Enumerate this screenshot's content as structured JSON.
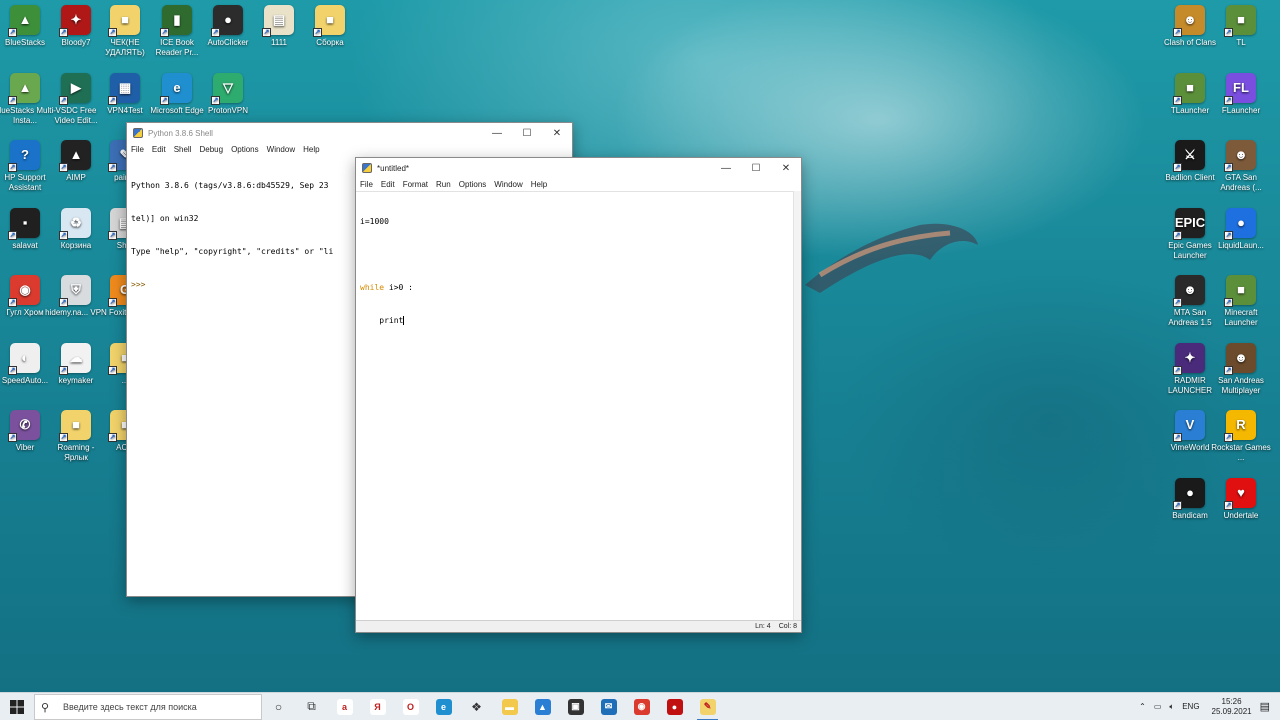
{
  "desktop": {
    "left_icons": [
      {
        "label": "BlueStacks",
        "color": "#3d8f3a",
        "glyph": "▲"
      },
      {
        "label": "Bloody7",
        "color": "#b01818",
        "glyph": "✦"
      },
      {
        "label": "ЧЕК(НЕ УДАЛЯТЬ)",
        "color": "#f2d36b",
        "glyph": "■"
      },
      {
        "label": "ICE Book Reader Pr...",
        "color": "#2f6b2f",
        "glyph": "▮"
      },
      {
        "label": "AutoClicker",
        "color": "#2c2c2c",
        "glyph": "●"
      },
      {
        "label": "1111",
        "color": "#e9e2c8",
        "glyph": "▤"
      },
      {
        "label": "Сборка",
        "color": "#f2d36b",
        "glyph": "■"
      },
      {
        "label": "BlueStacks Multi-Insta...",
        "color": "#6aa84f",
        "glyph": "▲"
      },
      {
        "label": "VSDC Free Video Edit...",
        "color": "#1f6f54",
        "glyph": "▶"
      },
      {
        "label": "VPN4Test",
        "color": "#1f5fa8",
        "glyph": "▦"
      },
      {
        "label": "Microsoft Edge",
        "color": "#1f8fd0",
        "glyph": "e"
      },
      {
        "label": "ProtonVPN",
        "color": "#2eab6e",
        "glyph": "▽"
      },
      {
        "label": "HP Support Assistant",
        "color": "#1a73c9",
        "glyph": "?"
      },
      {
        "label": "AIMP",
        "color": "#222222",
        "glyph": "▲"
      },
      {
        "label": "pain...",
        "color": "#3c6fb6",
        "glyph": "✎"
      },
      {
        "label": "salavat",
        "color": "#202020",
        "glyph": "▪"
      },
      {
        "label": "Корзина",
        "color": "#d8e7f2",
        "glyph": "♻"
      },
      {
        "label": "Sh...",
        "color": "#d6d6d6",
        "glyph": "▤"
      },
      {
        "label": "Гугл Хром",
        "color": "#db3b2f",
        "glyph": "◉"
      },
      {
        "label": "hidemy.na... VPN",
        "color": "#d9dcdf",
        "glyph": "⛨"
      },
      {
        "label": "Foxit R...",
        "color": "#f08a1c",
        "glyph": "G"
      },
      {
        "label": "SpeedAuto...",
        "color": "#efefef",
        "glyph": "◐"
      },
      {
        "label": "keymaker",
        "color": "#f2f2f2",
        "glyph": "☁"
      },
      {
        "label": "...",
        "color": "#f2d36b",
        "glyph": "■"
      },
      {
        "label": "Viber",
        "color": "#7b519d",
        "glyph": "✆"
      },
      {
        "label": "Roaming - Ярлык",
        "color": "#f2d36b",
        "glyph": "■"
      },
      {
        "label": "AC...",
        "color": "#f2d36b",
        "glyph": "■"
      }
    ],
    "right_icons": [
      {
        "label": "Clash of Clans",
        "color": "#c58a2a",
        "glyph": "☻"
      },
      {
        "label": "TL",
        "color": "#5c8f3a",
        "glyph": "■"
      },
      {
        "label": "TLauncher",
        "color": "#5c8f3a",
        "glyph": "■"
      },
      {
        "label": "FLauncher",
        "color": "#7a4fe0",
        "glyph": "FL"
      },
      {
        "label": "Badlion Client",
        "color": "#1a1a1a",
        "glyph": "⚔"
      },
      {
        "label": "GTA San Andreas (...",
        "color": "#7d5a3a",
        "glyph": "☻"
      },
      {
        "label": "Epic Games Launcher",
        "color": "#202020",
        "glyph": "EPIC"
      },
      {
        "label": "LiquidLaun...",
        "color": "#1e6fe0",
        "glyph": "●"
      },
      {
        "label": "MTA San Andreas 1.5",
        "color": "#2a2a2a",
        "glyph": "☻"
      },
      {
        "label": "Minecraft Launcher",
        "color": "#5c8f3a",
        "glyph": "■"
      },
      {
        "label": "RADMIR LAUNCHER",
        "color": "#4a2a7a",
        "glyph": "✦"
      },
      {
        "label": "San Andreas Multiplayer",
        "color": "#6b4b2b",
        "glyph": "☻"
      },
      {
        "label": "VimeWorld",
        "color": "#2a7fd4",
        "glyph": "V"
      },
      {
        "label": "Rockstar Games ...",
        "color": "#f5b800",
        "glyph": "R"
      },
      {
        "label": "Bandicam",
        "color": "#1a1a1a",
        "glyph": "●"
      },
      {
        "label": "Undertale",
        "color": "#e01010",
        "glyph": "♥"
      }
    ]
  },
  "shell_window": {
    "title": "Python 3.8.6 Shell",
    "menu": [
      "File",
      "Edit",
      "Shell",
      "Debug",
      "Options",
      "Window",
      "Help"
    ],
    "lines": [
      "Python 3.8.6 (tags/v3.8.6:db45529, Sep 23",
      "tel)] on win32",
      "Type \"help\", \"copyright\", \"credits\" or \"li",
      ">>>"
    ]
  },
  "editor_window": {
    "title": "*untitled*",
    "menu": [
      "File",
      "Edit",
      "Format",
      "Run",
      "Options",
      "Window",
      "Help"
    ],
    "code": {
      "line1": "i=1000",
      "line3_keyword": "while",
      "line3_rest": " i>0 :",
      "line4": "    print"
    },
    "status": {
      "line": "Ln: 4",
      "col": "Col: 8"
    }
  },
  "taskbar": {
    "search_placeholder": "Введите здесь текст для поиска",
    "apps": [
      {
        "name": "cortana-icon",
        "glyph": "○",
        "color": ""
      },
      {
        "name": "task-view-icon",
        "glyph": "⧉",
        "color": ""
      },
      {
        "name": "sticky-app-icon",
        "glyph": "a",
        "color": "#ffffff"
      },
      {
        "name": "yandex-icon",
        "glyph": "Я",
        "color": "#ffffff"
      },
      {
        "name": "opera-icon",
        "glyph": "O",
        "color": "#ffffff"
      },
      {
        "name": "edge-icon",
        "glyph": "e",
        "color": "#1f8fd0"
      },
      {
        "name": "dropbox-icon",
        "glyph": "❖",
        "color": ""
      },
      {
        "name": "explorer-icon",
        "glyph": "▬",
        "color": "#f2c94c"
      },
      {
        "name": "photos-icon",
        "glyph": "▲",
        "color": "#2a7fd4"
      },
      {
        "name": "store-icon",
        "glyph": "▣",
        "color": "#333333"
      },
      {
        "name": "mail-icon",
        "glyph": "✉",
        "color": "#1f6fb8"
      },
      {
        "name": "chrome-icon",
        "glyph": "◉",
        "color": "#db3b2f"
      },
      {
        "name": "bandicam-icon",
        "glyph": "●",
        "color": "#c01010"
      },
      {
        "name": "idle-icon",
        "glyph": "✎",
        "color": "#f2d36b"
      }
    ],
    "tray": {
      "lang": "ENG",
      "time": "15:26",
      "date": "25.09.2021"
    }
  }
}
